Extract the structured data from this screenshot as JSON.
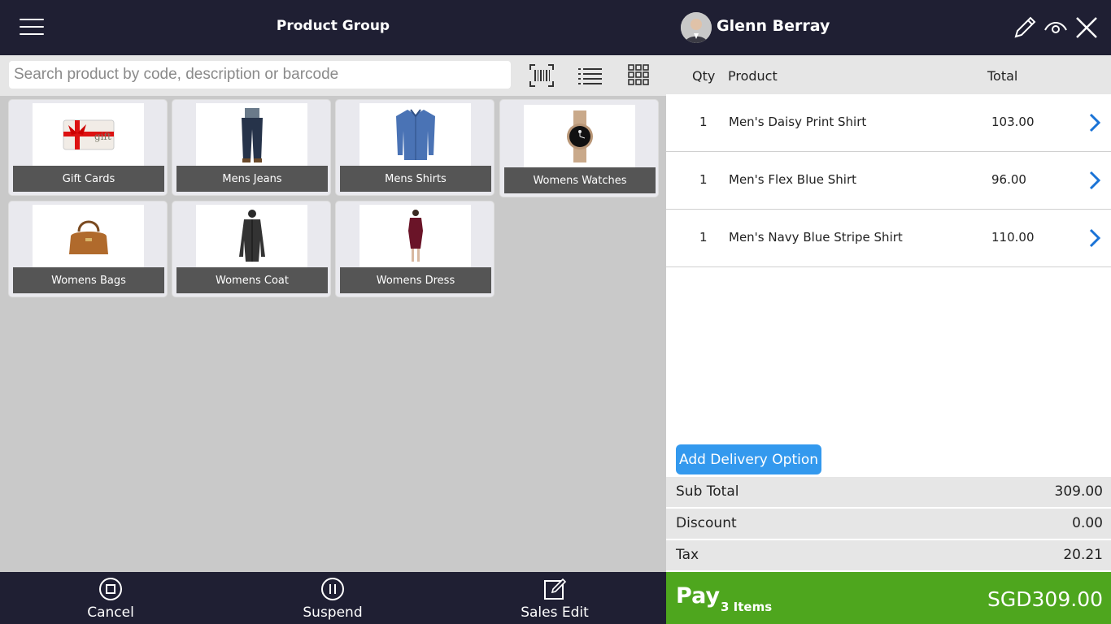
{
  "header": {
    "title": "Product Group"
  },
  "search": {
    "placeholder": "Search product by code, description or barcode"
  },
  "tiles": [
    {
      "label": "Gift Cards"
    },
    {
      "label": "Mens Jeans"
    },
    {
      "label": "Mens Shirts"
    },
    {
      "label": "Womens Watches"
    },
    {
      "label": "Womens Bags"
    },
    {
      "label": "Womens Coat"
    },
    {
      "label": "Womens Dress"
    }
  ],
  "bottom": {
    "cancel": "Cancel",
    "suspend": "Suspend",
    "sales_edit": "Sales Edit"
  },
  "customer": {
    "name": "Glenn Berray"
  },
  "cart": {
    "headers": {
      "qty": "Qty",
      "product": "Product",
      "total": "Total"
    },
    "items": [
      {
        "qty": "1",
        "product": "Men's Daisy Print Shirt",
        "total": "103.00"
      },
      {
        "qty": "1",
        "product": "Men's Flex Blue Shirt",
        "total": "96.00"
      },
      {
        "qty": "1",
        "product": "Men's Navy Blue Stripe Shirt",
        "total": "110.00"
      }
    ]
  },
  "delivery": {
    "label": "Add Delivery Option"
  },
  "summary": {
    "subtotal_label": "Sub Total",
    "subtotal": "309.00",
    "discount_label": "Discount",
    "discount": "0.00",
    "tax_label": "Tax",
    "tax": "20.21"
  },
  "pay": {
    "label": "Pay",
    "items": "3 Items",
    "amount": "SGD309.00"
  },
  "colors": {
    "dark": "#1f1f33",
    "accent": "#3399ee",
    "pay": "#4ea61e",
    "chevron": "#1a73d6"
  }
}
